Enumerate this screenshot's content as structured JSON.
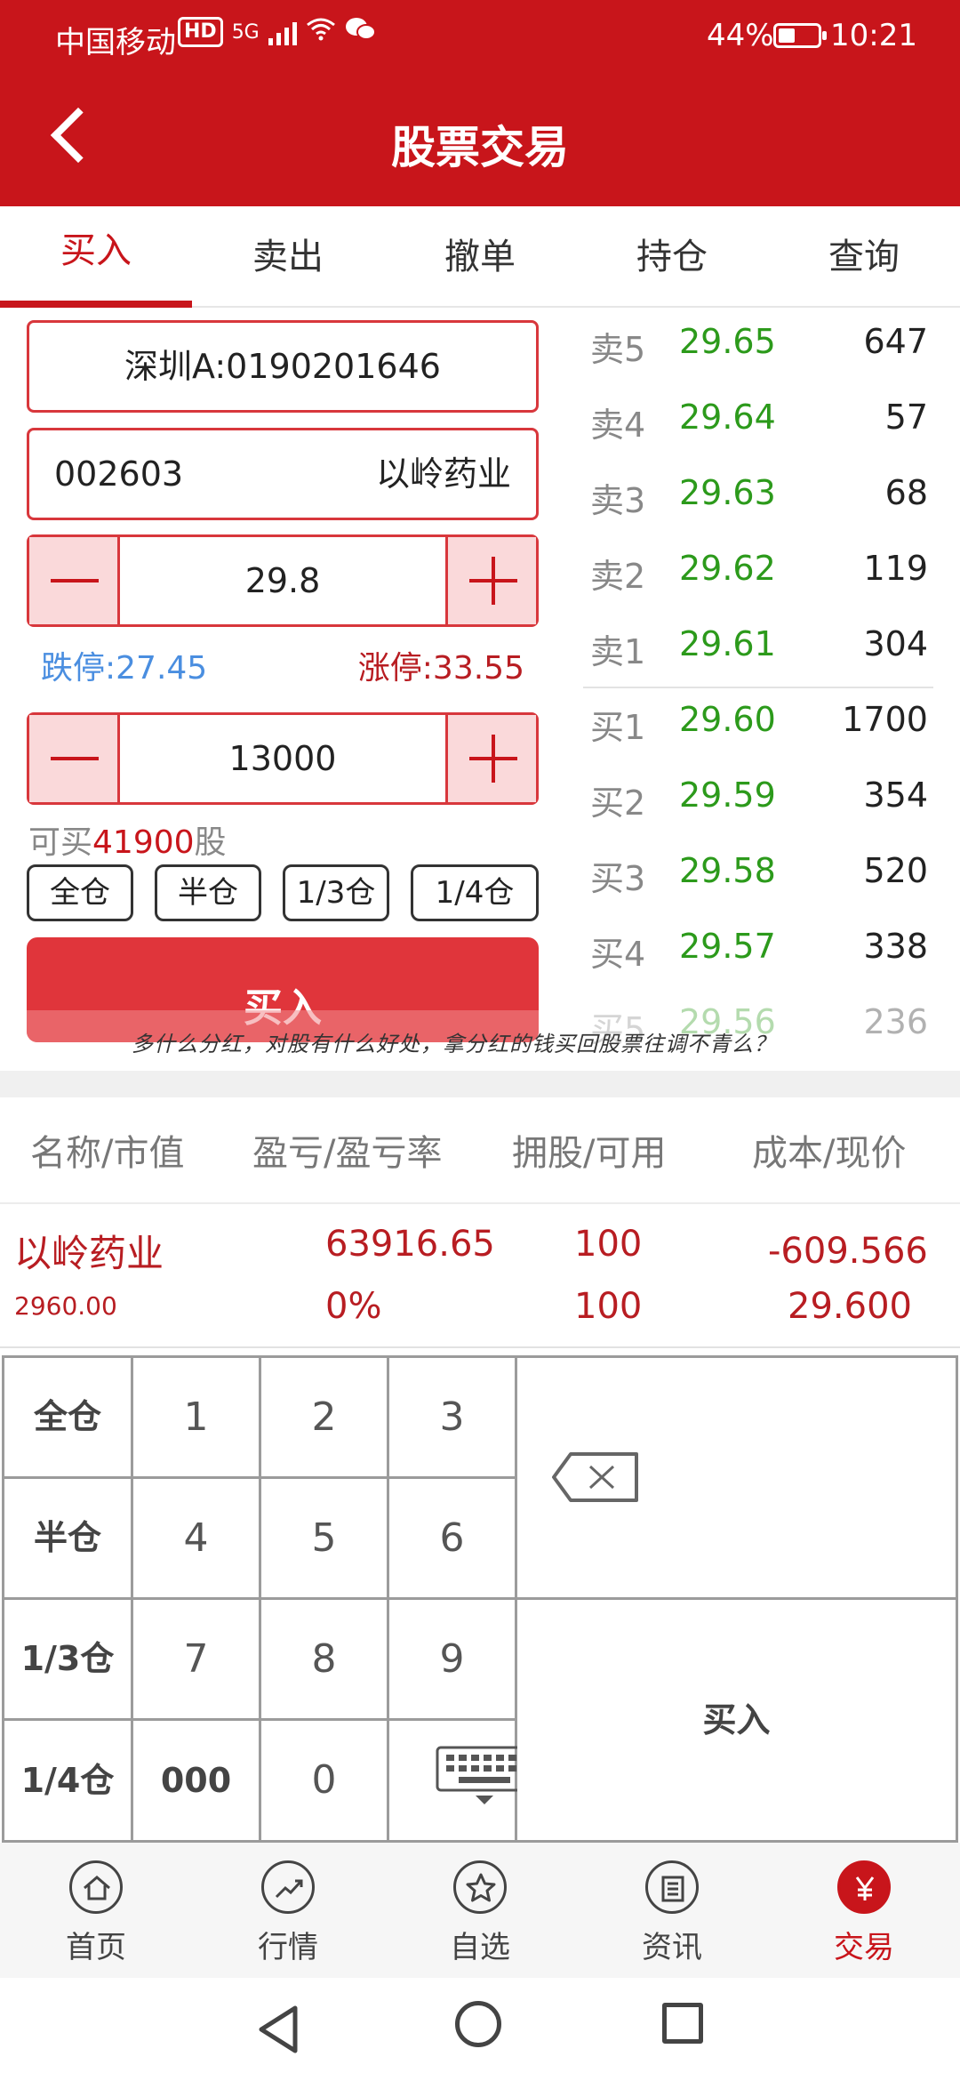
{
  "status_bar": {
    "carrier": "中国移动",
    "hd_label": "HD",
    "signal_label": "5G",
    "wifi_icon": "wifi-icon",
    "wechat_icon": "wechat-icon",
    "battery_percent": "44%",
    "battery_level": 0.44,
    "time": "10:21"
  },
  "header": {
    "title": "股票交易"
  },
  "tabs": [
    {
      "label": "买入",
      "active": true
    },
    {
      "label": "卖出"
    },
    {
      "label": "撤单"
    },
    {
      "label": "持仓"
    },
    {
      "label": "查询"
    }
  ],
  "order_form": {
    "account": "深圳A:0190201646",
    "stock_code": "002603",
    "stock_name": "以岭药业",
    "price": "29.8",
    "limit_down": "跌停:27.45",
    "limit_up": "涨停:33.55",
    "quantity": "13000",
    "can_buy_prefix": "可买",
    "can_buy_amount": "41900",
    "can_buy_suffix": "股",
    "quick_buttons": [
      "全仓",
      "半仓",
      "1/3仓",
      "1/4仓"
    ],
    "submit_label": "买入"
  },
  "order_book": {
    "sells": [
      {
        "label": "卖5",
        "price": "29.65",
        "volume": "647"
      },
      {
        "label": "卖4",
        "price": "29.64",
        "volume": "57"
      },
      {
        "label": "卖3",
        "price": "29.63",
        "volume": "68"
      },
      {
        "label": "卖2",
        "price": "29.62",
        "volume": "119"
      },
      {
        "label": "卖1",
        "price": "29.61",
        "volume": "304"
      }
    ],
    "buys": [
      {
        "label": "买1",
        "price": "29.60",
        "volume": "1700"
      },
      {
        "label": "买2",
        "price": "29.59",
        "volume": "354"
      },
      {
        "label": "买3",
        "price": "29.58",
        "volume": "520"
      },
      {
        "label": "买4",
        "price": "29.57",
        "volume": "338"
      },
      {
        "label": "买5",
        "price": "29.56",
        "volume": "236"
      }
    ]
  },
  "overlay_text": "多什么分红，对股有什么好处，拿分红的钱买回股票往调不青么？",
  "holdings": {
    "headers": [
      "名称/市值",
      "盈亏/盈亏率",
      "拥股/可用",
      "成本/现价"
    ],
    "row": {
      "name": "以岭药业",
      "market_value": "2960.00",
      "profit": "63916.65",
      "profit_rate": "0%",
      "shares": "100",
      "available": "100",
      "cost": "-609.566",
      "current_price": "29.600"
    }
  },
  "keypad": {
    "side_keys": [
      "全仓",
      "半仓",
      "1/3仓",
      "1/4仓"
    ],
    "digits": [
      "1",
      "2",
      "3",
      "4",
      "5",
      "6",
      "7",
      "8",
      "9",
      "000",
      "0"
    ],
    "delete_icon": "backspace-icon",
    "keyboard_icon": "keyboard-hide-icon",
    "confirm_label": "买入"
  },
  "bottom_nav": [
    {
      "label": "首页",
      "icon": "home-icon"
    },
    {
      "label": "行情",
      "icon": "chart-icon"
    },
    {
      "label": "自选",
      "icon": "star-icon"
    },
    {
      "label": "资讯",
      "icon": "news-icon"
    },
    {
      "label": "交易",
      "icon": "yen-icon",
      "active": true
    }
  ],
  "colors": {
    "brand_red": "#c8151b",
    "price_green": "#2c9a1b",
    "limit_down_blue": "#4a8ee0"
  }
}
